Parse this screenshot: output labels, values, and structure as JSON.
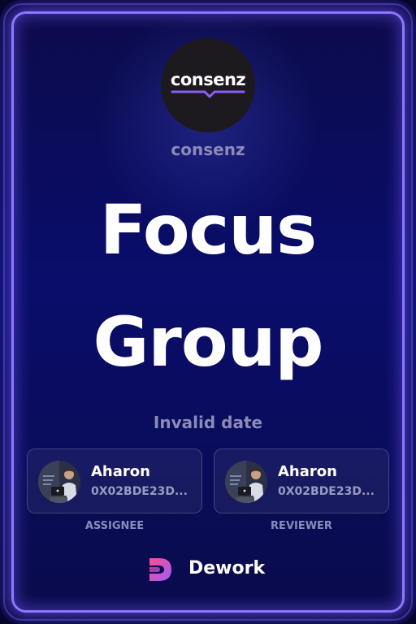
{
  "organization": {
    "logo_text": "consenz",
    "name": "consenz"
  },
  "task": {
    "title_line1": "Focus",
    "title_line2": "Group",
    "date": "Invalid date"
  },
  "assignee": {
    "name": "Aharon",
    "address": "0X02BDE23D...",
    "role": "ASSIGNEE"
  },
  "reviewer": {
    "name": "Aharon",
    "address": "0X02BDE23D...",
    "role": "REVIEWER"
  },
  "brand": {
    "name": "Dework",
    "icon": "dework-logo-icon"
  },
  "colors": {
    "background": "#0a0d6b",
    "frame": "#8f76ff",
    "muted_text": "#8a8bb8",
    "logo_accent": "#8a5cf6"
  }
}
